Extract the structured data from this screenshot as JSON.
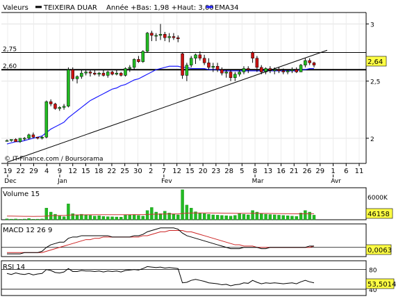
{
  "header": {
    "label": "Valeurs",
    "stock": "TEIXEIRA DUAR",
    "range": "Année +Bas: 1,98 +Haut: 3,00",
    "ema_label": "EMA34"
  },
  "colors": {
    "up": "#22bb22",
    "down": "#cc1111",
    "ema": "#1a1aff",
    "macd_signal": "#cc2222",
    "volume_avg": "#cc3333",
    "price_box": "#ffff44",
    "grid": "#dddddd"
  },
  "chart_data": [
    {
      "type": "candlestick",
      "ylim": [
        1.78,
        3.1
      ],
      "yticks": [
        "2",
        "2,5",
        "3"
      ],
      "hlines": [
        {
          "label": "2,75",
          "value": 2.75
        },
        {
          "label": "2,60",
          "value": 2.6
        }
      ],
      "current": "2,64",
      "copyright": "© IT-Finance.com / Boursorama",
      "xticks": [
        "19",
        "22",
        "29",
        "4",
        "9",
        "12",
        "15",
        "18",
        "22",
        "25",
        "30",
        "2",
        "7",
        "12",
        "15",
        "20",
        "23",
        "28",
        "5",
        "8",
        "13",
        "16",
        "21",
        "26",
        "29",
        "1",
        "6",
        "11"
      ],
      "months": [
        "Dec",
        "Jan",
        "Fev",
        "Mar",
        "Avr"
      ],
      "ohlc": [
        [
          1.98,
          1.99,
          1.98,
          1.98
        ],
        [
          1.98,
          1.99,
          1.97,
          1.99
        ],
        [
          1.99,
          2.0,
          1.97,
          1.97
        ],
        [
          1.97,
          2.0,
          1.96,
          2.0
        ],
        [
          2.0,
          2.01,
          1.98,
          2.0
        ],
        [
          2.0,
          2.04,
          1.99,
          2.03
        ],
        [
          2.03,
          2.05,
          2.0,
          2.01
        ],
        [
          2.01,
          2.01,
          1.99,
          2.0
        ],
        [
          2.0,
          2.02,
          1.99,
          2.01
        ],
        [
          2.01,
          2.33,
          2.0,
          2.32
        ],
        [
          2.32,
          2.34,
          2.28,
          2.3
        ],
        [
          2.3,
          2.31,
          2.25,
          2.26
        ],
        [
          2.26,
          2.28,
          2.24,
          2.27
        ],
        [
          2.27,
          2.3,
          2.25,
          2.28
        ],
        [
          2.28,
          2.62,
          2.27,
          2.6
        ],
        [
          2.6,
          2.62,
          2.5,
          2.52
        ],
        [
          2.52,
          2.55,
          2.48,
          2.54
        ],
        [
          2.54,
          2.6,
          2.52,
          2.57
        ],
        [
          2.57,
          2.6,
          2.55,
          2.58
        ],
        [
          2.58,
          2.6,
          2.54,
          2.57
        ],
        [
          2.57,
          2.6,
          2.55,
          2.56
        ],
        [
          2.56,
          2.58,
          2.54,
          2.57
        ],
        [
          2.57,
          2.6,
          2.54,
          2.55
        ],
        [
          2.55,
          2.59,
          2.53,
          2.58
        ],
        [
          2.58,
          2.59,
          2.55,
          2.56
        ],
        [
          2.56,
          2.6,
          2.55,
          2.57
        ],
        [
          2.57,
          2.58,
          2.54,
          2.55
        ],
        [
          2.55,
          2.62,
          2.54,
          2.61
        ],
        [
          2.61,
          2.64,
          2.58,
          2.62
        ],
        [
          2.62,
          2.7,
          2.6,
          2.69
        ],
        [
          2.69,
          2.72,
          2.66,
          2.67
        ],
        [
          2.67,
          2.77,
          2.66,
          2.76
        ],
        [
          2.76,
          2.93,
          2.75,
          2.92
        ],
        [
          2.92,
          2.94,
          2.85,
          2.9
        ],
        [
          2.9,
          2.92,
          2.85,
          2.9
        ],
        [
          2.9,
          3.0,
          2.86,
          2.91
        ],
        [
          2.91,
          2.93,
          2.85,
          2.88
        ],
        [
          2.88,
          2.92,
          2.84,
          2.89
        ],
        [
          2.89,
          2.92,
          2.86,
          2.88
        ],
        [
          2.88,
          2.9,
          2.84,
          2.87
        ],
        [
          2.74,
          2.75,
          2.52,
          2.55
        ],
        [
          2.55,
          2.66,
          2.5,
          2.64
        ],
        [
          2.64,
          2.72,
          2.62,
          2.7
        ],
        [
          2.7,
          2.74,
          2.65,
          2.73
        ],
        [
          2.73,
          2.76,
          2.68,
          2.7
        ],
        [
          2.7,
          2.73,
          2.64,
          2.66
        ],
        [
          2.66,
          2.7,
          2.6,
          2.62
        ],
        [
          2.62,
          2.66,
          2.58,
          2.63
        ],
        [
          2.63,
          2.66,
          2.58,
          2.6
        ],
        [
          2.6,
          2.62,
          2.55,
          2.57
        ],
        [
          2.57,
          2.6,
          2.53,
          2.58
        ],
        [
          2.58,
          2.6,
          2.5,
          2.53
        ],
        [
          2.53,
          2.58,
          2.5,
          2.56
        ],
        [
          2.56,
          2.6,
          2.54,
          2.58
        ],
        [
          2.58,
          2.63,
          2.56,
          2.61
        ],
        [
          2.61,
          2.63,
          2.57,
          2.6
        ],
        [
          2.75,
          2.76,
          2.66,
          2.7
        ],
        [
          2.7,
          2.72,
          2.58,
          2.62
        ],
        [
          2.62,
          2.64,
          2.56,
          2.58
        ],
        [
          2.58,
          2.62,
          2.56,
          2.61
        ],
        [
          2.61,
          2.63,
          2.57,
          2.59
        ],
        [
          2.59,
          2.62,
          2.56,
          2.6
        ],
        [
          2.6,
          2.62,
          2.57,
          2.59
        ],
        [
          2.59,
          2.61,
          2.56,
          2.58
        ],
        [
          2.58,
          2.6,
          2.56,
          2.59
        ],
        [
          2.59,
          2.62,
          2.57,
          2.6
        ],
        [
          2.6,
          2.62,
          2.57,
          2.58
        ],
        [
          2.58,
          2.65,
          2.58,
          2.64
        ],
        [
          2.64,
          2.7,
          2.62,
          2.68
        ],
        [
          2.68,
          2.7,
          2.64,
          2.66
        ],
        [
          2.66,
          2.67,
          2.62,
          2.64
        ]
      ],
      "ema34": [
        1.95,
        1.96,
        1.97,
        1.97,
        1.98,
        1.99,
        2.0,
        2.01,
        2.02,
        2.05,
        2.08,
        2.1,
        2.12,
        2.14,
        2.18,
        2.21,
        2.24,
        2.27,
        2.3,
        2.33,
        2.35,
        2.37,
        2.39,
        2.41,
        2.43,
        2.44,
        2.46,
        2.47,
        2.49,
        2.51,
        2.52,
        2.54,
        2.56,
        2.58,
        2.6,
        2.61,
        2.62,
        2.63,
        2.63,
        2.63,
        2.62,
        2.62,
        2.61,
        2.61,
        2.61,
        2.61,
        2.6,
        2.6,
        2.6,
        2.59,
        2.59,
        2.59,
        2.59,
        2.59,
        2.59,
        2.59,
        2.59,
        2.59,
        2.59,
        2.59,
        2.59,
        2.59,
        2.59,
        2.59,
        2.59,
        2.59,
        2.59,
        2.6,
        2.6,
        2.61,
        2.61
      ],
      "trendline": [
        [
          0,
          1.79
        ],
        [
          73,
          2.77
        ]
      ]
    },
    {
      "type": "bar",
      "title": "Volume 15",
      "ylabel": "6000K",
      "current": "46158",
      "values": [
        30,
        20,
        25,
        15,
        22,
        40,
        18,
        20,
        25,
        380,
        250,
        180,
        120,
        100,
        520,
        200,
        150,
        180,
        160,
        140,
        120,
        130,
        110,
        100,
        95,
        90,
        85,
        150,
        160,
        170,
        140,
        120,
        300,
        400,
        250,
        200,
        280,
        220,
        180,
        160,
        980,
        480,
        380,
        260,
        220,
        200,
        180,
        160,
        150,
        140,
        130,
        120,
        140,
        200,
        180,
        160,
        300,
        250,
        200,
        180,
        170,
        160,
        150,
        140,
        130,
        120,
        110,
        220,
        300,
        250,
        150
      ],
      "avg": [
        120,
        118,
        116,
        114,
        112,
        110,
        108,
        110,
        112,
        120,
        130,
        135,
        138,
        140,
        150,
        155,
        158,
        160,
        162,
        163,
        164,
        165,
        166,
        166,
        166,
        165,
        164,
        165,
        166,
        167,
        168,
        168,
        172,
        178,
        182,
        185,
        188,
        190,
        190,
        190,
        205,
        215,
        220,
        222,
        222,
        222,
        221,
        220,
        218,
        216,
        214,
        212,
        210,
        210,
        210,
        209,
        210,
        210,
        208,
        206,
        204,
        202,
        200,
        198,
        196,
        194,
        192,
        193,
        195,
        196,
        196
      ]
    },
    {
      "type": "line",
      "title": "MACD 12 26 9",
      "current": "0,0063",
      "macd": [
        -0.05,
        -0.05,
        -0.05,
        -0.05,
        -0.04,
        -0.04,
        -0.04,
        -0.04,
        -0.03,
        0.0,
        0.02,
        0.03,
        0.04,
        0.04,
        0.07,
        0.08,
        0.08,
        0.09,
        0.09,
        0.09,
        0.09,
        0.09,
        0.09,
        0.09,
        0.08,
        0.08,
        0.08,
        0.08,
        0.08,
        0.09,
        0.09,
        0.1,
        0.12,
        0.13,
        0.14,
        0.15,
        0.15,
        0.15,
        0.15,
        0.14,
        0.11,
        0.09,
        0.08,
        0.07,
        0.06,
        0.05,
        0.04,
        0.03,
        0.02,
        0.01,
        0.0,
        -0.01,
        -0.01,
        -0.01,
        0.0,
        0.0,
        0.0,
        0.0,
        -0.01,
        -0.01,
        0.0,
        0.0,
        0.0,
        0.0,
        0.0,
        0.0,
        0.0,
        0.0,
        0.0,
        0.01,
        0.01
      ],
      "signal": [
        -0.04,
        -0.04,
        -0.04,
        -0.04,
        -0.04,
        -0.04,
        -0.04,
        -0.04,
        -0.04,
        -0.03,
        -0.02,
        -0.01,
        0.0,
        0.01,
        0.02,
        0.03,
        0.04,
        0.05,
        0.06,
        0.06,
        0.07,
        0.07,
        0.08,
        0.08,
        0.08,
        0.08,
        0.08,
        0.08,
        0.08,
        0.08,
        0.08,
        0.09,
        0.09,
        0.1,
        0.11,
        0.12,
        0.12,
        0.13,
        0.13,
        0.13,
        0.13,
        0.12,
        0.12,
        0.11,
        0.1,
        0.09,
        0.08,
        0.07,
        0.06,
        0.05,
        0.04,
        0.03,
        0.02,
        0.02,
        0.01,
        0.01,
        0.01,
        0.0,
        0.0,
        0.0,
        0.0,
        0.0,
        0.0,
        0.0,
        0.0,
        0.0,
        0.0,
        0.0,
        0.0,
        0.0,
        0.01
      ]
    },
    {
      "type": "line",
      "title": "RSI 14",
      "yticks": [
        "80",
        "40"
      ],
      "current": "53,5014",
      "values": [
        72,
        70,
        73,
        71,
        70,
        72,
        69,
        71,
        72,
        80,
        78,
        74,
        73,
        75,
        82,
        76,
        76,
        78,
        77,
        77,
        76,
        77,
        75,
        77,
        76,
        77,
        75,
        78,
        79,
        80,
        79,
        82,
        86,
        85,
        84,
        85,
        83,
        84,
        83,
        82,
        53,
        54,
        58,
        60,
        58,
        56,
        53,
        52,
        51,
        49,
        50,
        47,
        49,
        50,
        53,
        52,
        58,
        54,
        51,
        53,
        52,
        53,
        52,
        51,
        52,
        53,
        51,
        55,
        58,
        55,
        53
      ]
    }
  ]
}
